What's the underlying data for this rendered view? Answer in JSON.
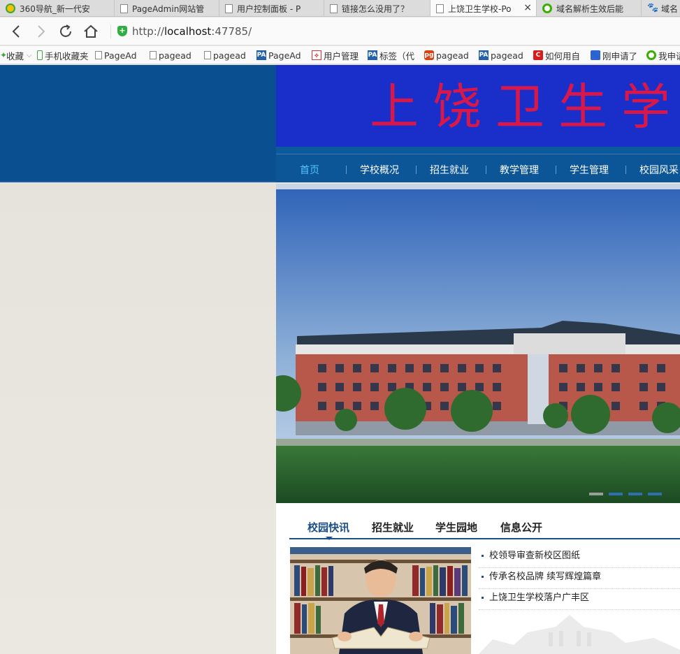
{
  "browser": {
    "tabs": [
      {
        "title": "360导航_新一代安",
        "icon": "360-icon"
      },
      {
        "title": "PageAdmin网站管",
        "icon": "page-icon"
      },
      {
        "title": "用户控制面板 - P",
        "icon": "page-icon"
      },
      {
        "title": "链接怎么没用了？",
        "icon": "page-icon"
      },
      {
        "title": "上饶卫生学校-Po",
        "icon": "page-icon",
        "active": true
      },
      {
        "title": "域名解析生效后能",
        "icon": "360-search-icon"
      },
      {
        "title": "域名",
        "icon": "paw-icon"
      }
    ],
    "close_glyph": "×",
    "url_prefix": "http://",
    "url_host": "localhost",
    "url_rest": ":47785/",
    "shield_glyph": "+",
    "bookmarks": [
      {
        "label": "收藏",
        "icon": "star-icon"
      },
      {
        "label": "手机收藏夹",
        "icon": "phone-icon"
      },
      {
        "label": "PageAd",
        "icon": "page-icon"
      },
      {
        "label": "pagead",
        "icon": "page-icon"
      },
      {
        "label": "pagead",
        "icon": "page-icon"
      },
      {
        "label": "PageAd",
        "icon": "pa-icon"
      },
      {
        "label": "用户管理",
        "icon": "user-icon"
      },
      {
        "label": "标签（代",
        "icon": "pa-icon"
      },
      {
        "label": "pagead",
        "icon": "pagead-icon"
      },
      {
        "label": "pagead",
        "icon": "pa-icon"
      },
      {
        "label": "如何用自",
        "icon": "c-icon"
      },
      {
        "label": "刚申请了",
        "icon": "paw-icon"
      },
      {
        "label": "我申请",
        "icon": "360-search-icon"
      }
    ],
    "bookmark_dropdown_glyph": "⌵",
    "pa_glyph": "PA",
    "c_glyph": "C",
    "paw_glyph": "🐾",
    "pg_glyph": "pg"
  },
  "site": {
    "banner_title": "上饶卫生学",
    "nav": [
      "首页",
      "学校概况",
      "招生就业",
      "教学管理",
      "学生管理",
      "校园风采"
    ],
    "nav_active_index": 0,
    "hero_slide_count": 4,
    "hero_active_index": 0,
    "section_tabs": [
      "校园快讯",
      "招生就业",
      "学生园地",
      "信息公开"
    ],
    "section_active_index": 0,
    "news": [
      "校领导审查新校区图纸",
      "传承名校品牌 续写辉煌篇章",
      "上饶卫生学校落户广丰区"
    ]
  },
  "colors": {
    "header_blue": "#0a4f8f",
    "banner_blue": "#1a2fc9",
    "banner_red": "#d8174a",
    "nav_active": "#51c6ff",
    "section_blue": "#1d4f87"
  }
}
